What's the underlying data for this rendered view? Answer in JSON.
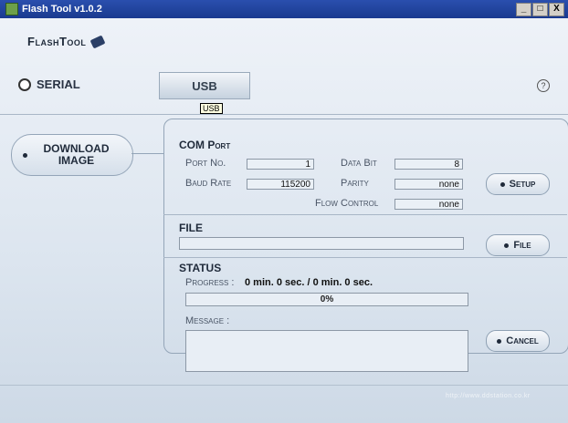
{
  "window": {
    "title": "Flash Tool v1.0.2",
    "controls": {
      "minimize": "_",
      "maximize": "□",
      "close": "X"
    }
  },
  "header": {
    "logo_text": "FlashTool",
    "serial_label": "SERIAL",
    "usb_label": "USB",
    "tooltip": "USB",
    "help_glyph": "?"
  },
  "sidebar": {
    "download_line1": "DOWNLOAD",
    "download_line2": "IMAGE"
  },
  "com": {
    "title": "COM Port",
    "port_label": "Port No.",
    "port_value": "1",
    "baud_label": "Baud Rate",
    "baud_value": "115200",
    "databit_label": "Data Bit",
    "databit_value": "8",
    "parity_label": "Parity",
    "parity_value": "none",
    "flow_label": "Flow Control",
    "flow_value": "none",
    "setup_label": "Setup"
  },
  "file": {
    "title": "FILE",
    "value": "",
    "button_label": "File"
  },
  "status": {
    "title": "STATUS",
    "progress_label": "Progress :",
    "progress_time": "0 min. 0 sec. / 0 min. 0 sec.",
    "progress_percent": "0%",
    "progress_fraction": 0,
    "message_label": "Message :",
    "message_value": "",
    "cancel_label": "Cancel"
  },
  "footer": {
    "url": "http://www.ddstation.co.kr"
  }
}
